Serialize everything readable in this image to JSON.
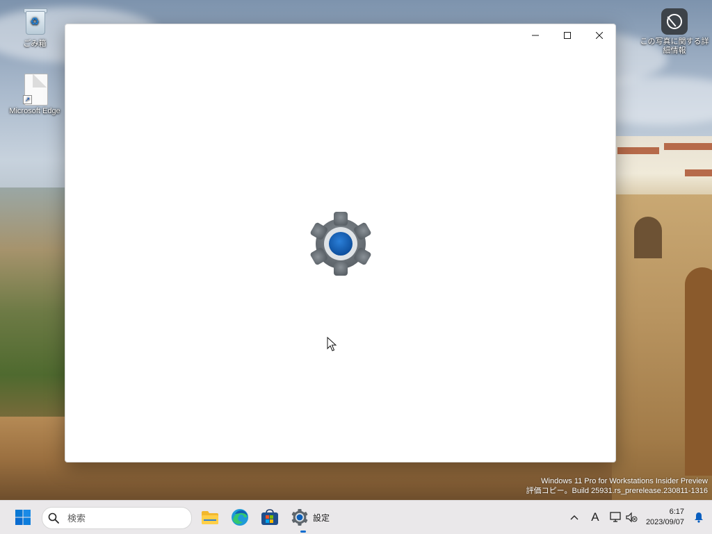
{
  "desktop": {
    "icons": [
      {
        "label": "ごみ箱",
        "icon": "recycle-bin-icon"
      },
      {
        "label": "Microsoft Edge",
        "icon": "file-shortcut-icon"
      },
      {
        "label": "この写真に関する詳細情報",
        "icon": "photo-info-icon"
      }
    ],
    "watermark": {
      "line1": "Windows 11 Pro for Workstations Insider Preview",
      "line2": "評価コピー。Build 25931.rs_prerelease.230811-1316"
    }
  },
  "window": {
    "controls": {
      "minimize": "minimize-icon",
      "maximize": "maximize-icon",
      "close": "close-icon"
    },
    "splash_icon": "settings-gear-icon"
  },
  "taskbar": {
    "start": "windows-start-icon",
    "search": {
      "placeholder": "検索"
    },
    "apps": [
      {
        "name": "file-explorer",
        "icon": "folder-icon"
      },
      {
        "name": "edge",
        "icon": "edge-icon"
      },
      {
        "name": "store",
        "icon": "store-icon"
      },
      {
        "name": "settings",
        "icon": "settings-gear-icon",
        "label": "設定",
        "active": true
      }
    ],
    "tray": {
      "chevron": "^",
      "ime": "A",
      "time": "6:17",
      "date": "2023/09/07"
    }
  },
  "colors": {
    "accent": "#0a6cd0",
    "taskbar_bg": "#eae8ea",
    "window_bg": "#ffffff"
  }
}
